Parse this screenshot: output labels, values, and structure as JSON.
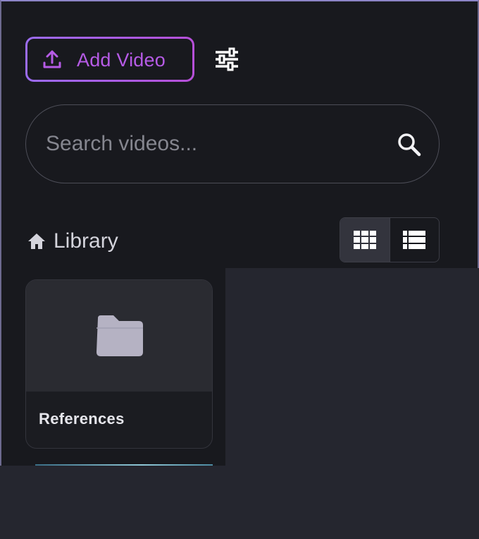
{
  "toolbar": {
    "add_video_label": "Add Video",
    "add_video_icon": "upload-icon",
    "filter_icon": "sliders-icon",
    "accent_color": "#b65be6"
  },
  "search": {
    "placeholder": "Search videos...",
    "value": "",
    "icon": "search-icon"
  },
  "breadcrumb": {
    "icon": "home-icon",
    "label": "Library"
  },
  "view_toggle": {
    "options": [
      "grid-view",
      "list-view"
    ],
    "selected": "grid-view"
  },
  "items": [
    {
      "type": "folder",
      "name": "References",
      "icon": "folder-icon"
    }
  ]
}
